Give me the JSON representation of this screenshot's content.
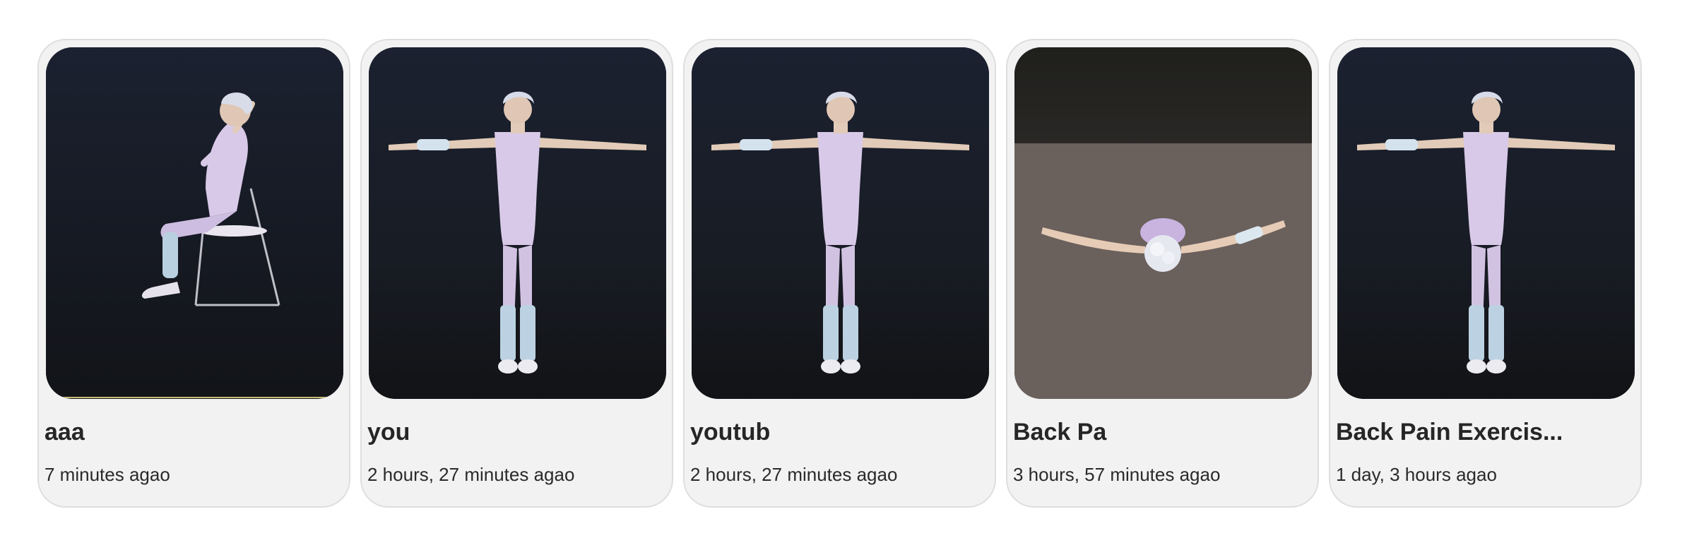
{
  "cards": [
    {
      "title": "aaa",
      "time": "7 minutes agao",
      "pose": "seated"
    },
    {
      "title": "you",
      "time": "2 hours, 27 minutes agao",
      "pose": "t-pose"
    },
    {
      "title": "youtub",
      "time": "2 hours, 27 minutes agao",
      "pose": "t-pose"
    },
    {
      "title": "Back Pa",
      "time": "3 hours, 57 minutes agao",
      "pose": "top-down"
    },
    {
      "title": "Back Pain Exercis...",
      "time": "1 day, 3 hours agao",
      "pose": "t-pose"
    }
  ]
}
